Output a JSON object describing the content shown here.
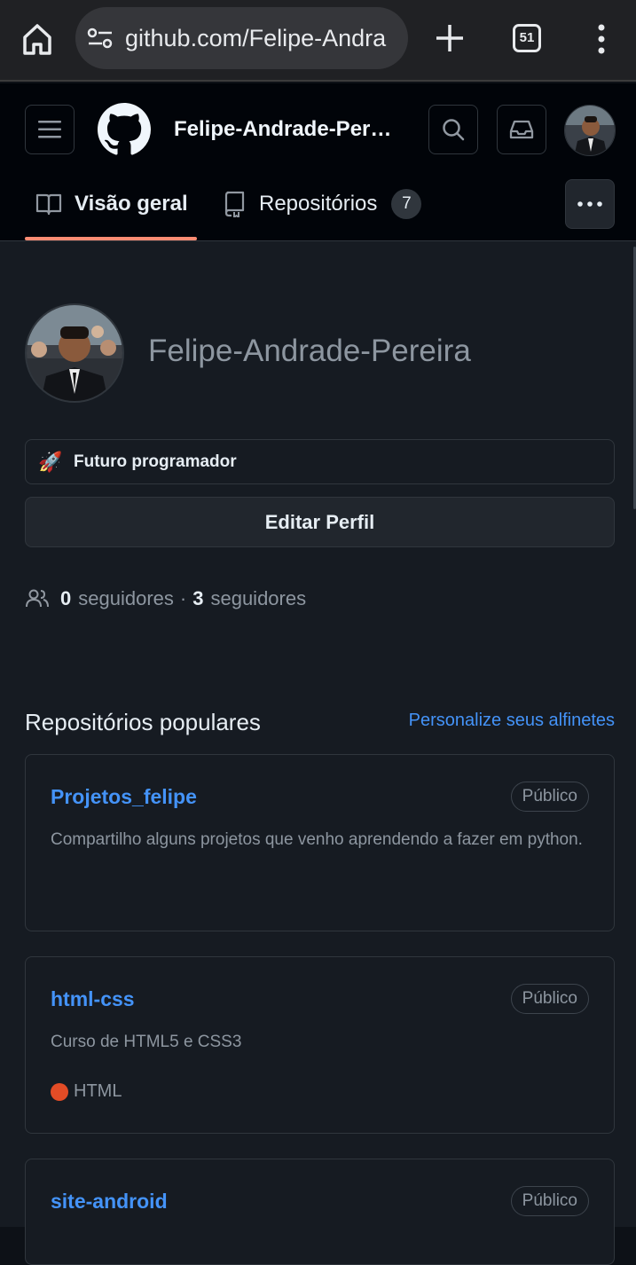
{
  "browser": {
    "url": "github.com/Felipe-Andra",
    "tab_count": "51"
  },
  "header": {
    "username": "Felipe-Andrade-Pereira",
    "tabs": [
      {
        "label": "Visão geral",
        "active": true
      },
      {
        "label": "Repositórios",
        "count": "7"
      }
    ]
  },
  "profile": {
    "name": "Felipe-Andrade-Pereira",
    "status_emoji": "🚀",
    "status_text": "Futuro programador",
    "edit_label": "Editar Perfil",
    "followers_count": "0",
    "followers_label": "seguidores",
    "separator": "·",
    "following_count": "3",
    "following_label": "seguidores"
  },
  "popular": {
    "title": "Repositórios populares",
    "customize_label": "Personalize seus alfinetes",
    "repos": [
      {
        "name": "Projetos_felipe",
        "visibility": "Público",
        "description": "Compartilho alguns projetos que venho aprendendo a fazer em python."
      },
      {
        "name": "html-css",
        "visibility": "Público",
        "description": "Curso de HTML5 e CSS3",
        "language": "HTML",
        "language_color": "#e34c26"
      },
      {
        "name": "site-android",
        "visibility": "Público"
      }
    ]
  },
  "colors": {
    "accent_link": "#4493f8",
    "tab_underline": "#fd8c73",
    "notification": "#2f81f7"
  }
}
